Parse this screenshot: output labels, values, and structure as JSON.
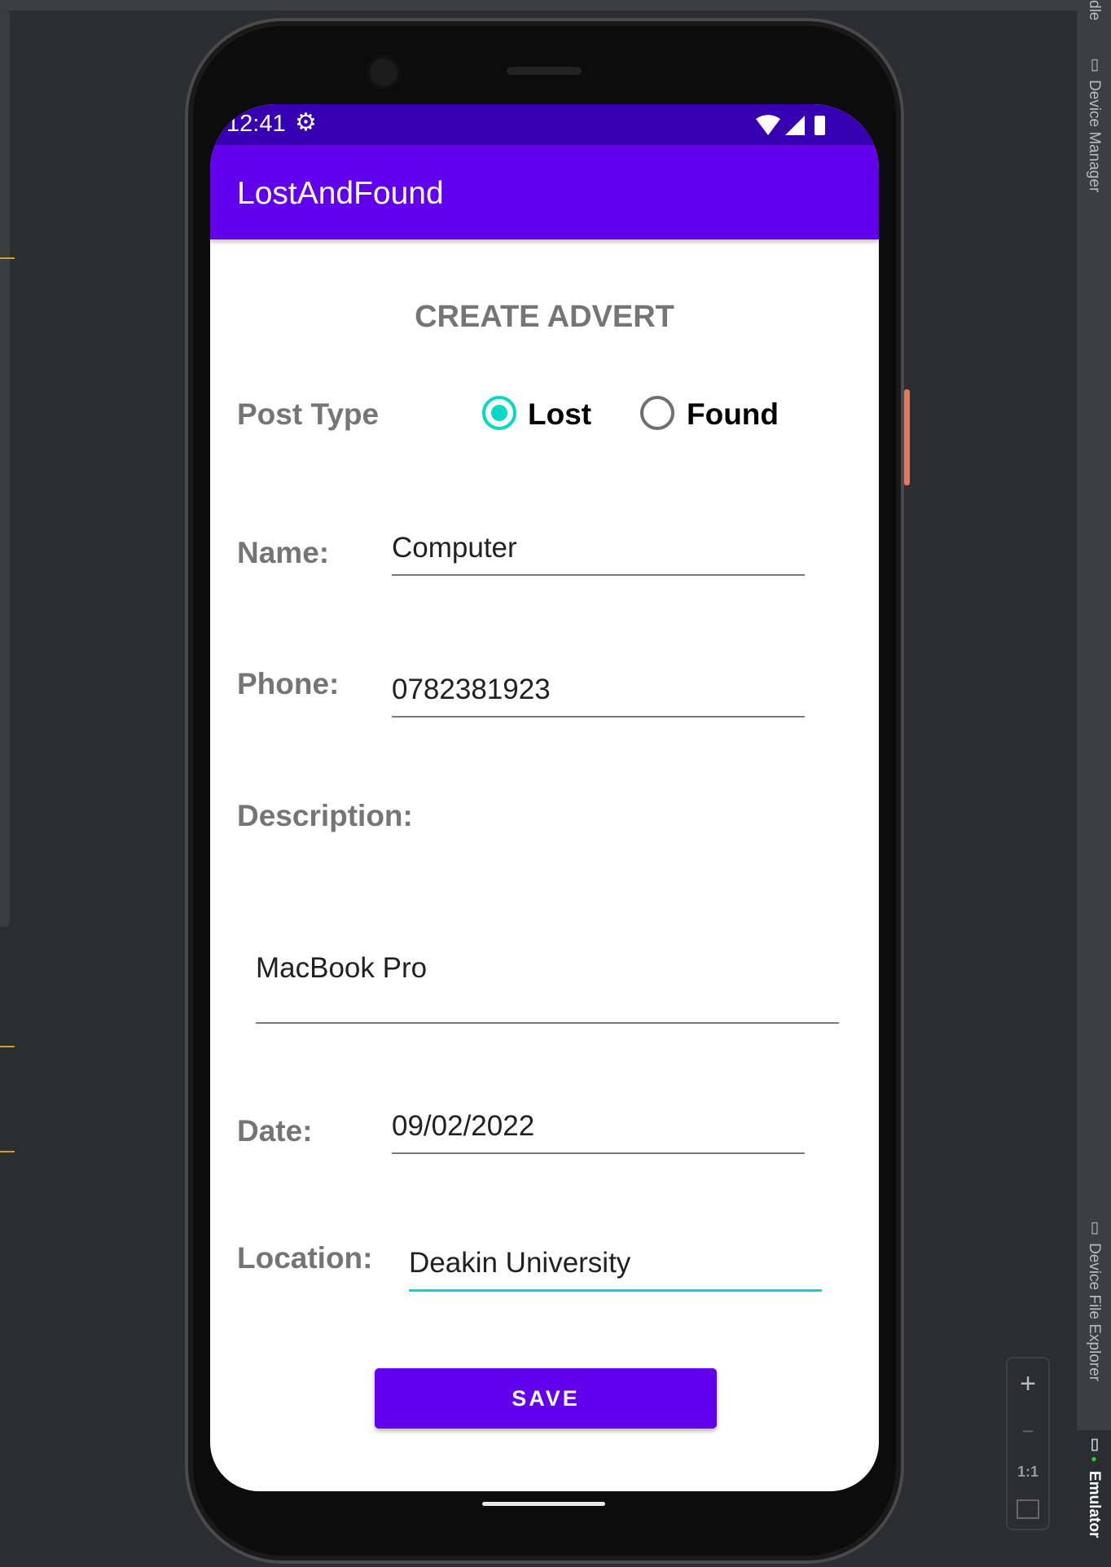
{
  "ide": {
    "tabs": {
      "top_partial": "dle",
      "device_manager": "Device Manager",
      "device_file_explorer": "Device File Explorer",
      "emulator": "Emulator"
    },
    "zoom": {
      "zoom_in": "+",
      "zoom_out": "−",
      "actual_size": "1:1"
    }
  },
  "status_bar": {
    "time": "12:41"
  },
  "app": {
    "title": "LostAndFound",
    "heading": "CREATE ADVERT",
    "post_type": {
      "label": "Post Type",
      "options": [
        "Lost",
        "Found"
      ],
      "selected": "Lost"
    },
    "name": {
      "label": "Name:",
      "value": "Computer"
    },
    "phone": {
      "label": "Phone:",
      "value": "0782381923"
    },
    "description": {
      "label": "Description:",
      "value": "MacBook Pro"
    },
    "date": {
      "label": "Date:",
      "value": "09/02/2022"
    },
    "location": {
      "label": "Location:",
      "value": "Deakin University"
    },
    "save_label": "SAVE"
  },
  "colors": {
    "primary": "#6200ee",
    "primary_dark": "#3700b3",
    "accent": "#03dac5"
  }
}
